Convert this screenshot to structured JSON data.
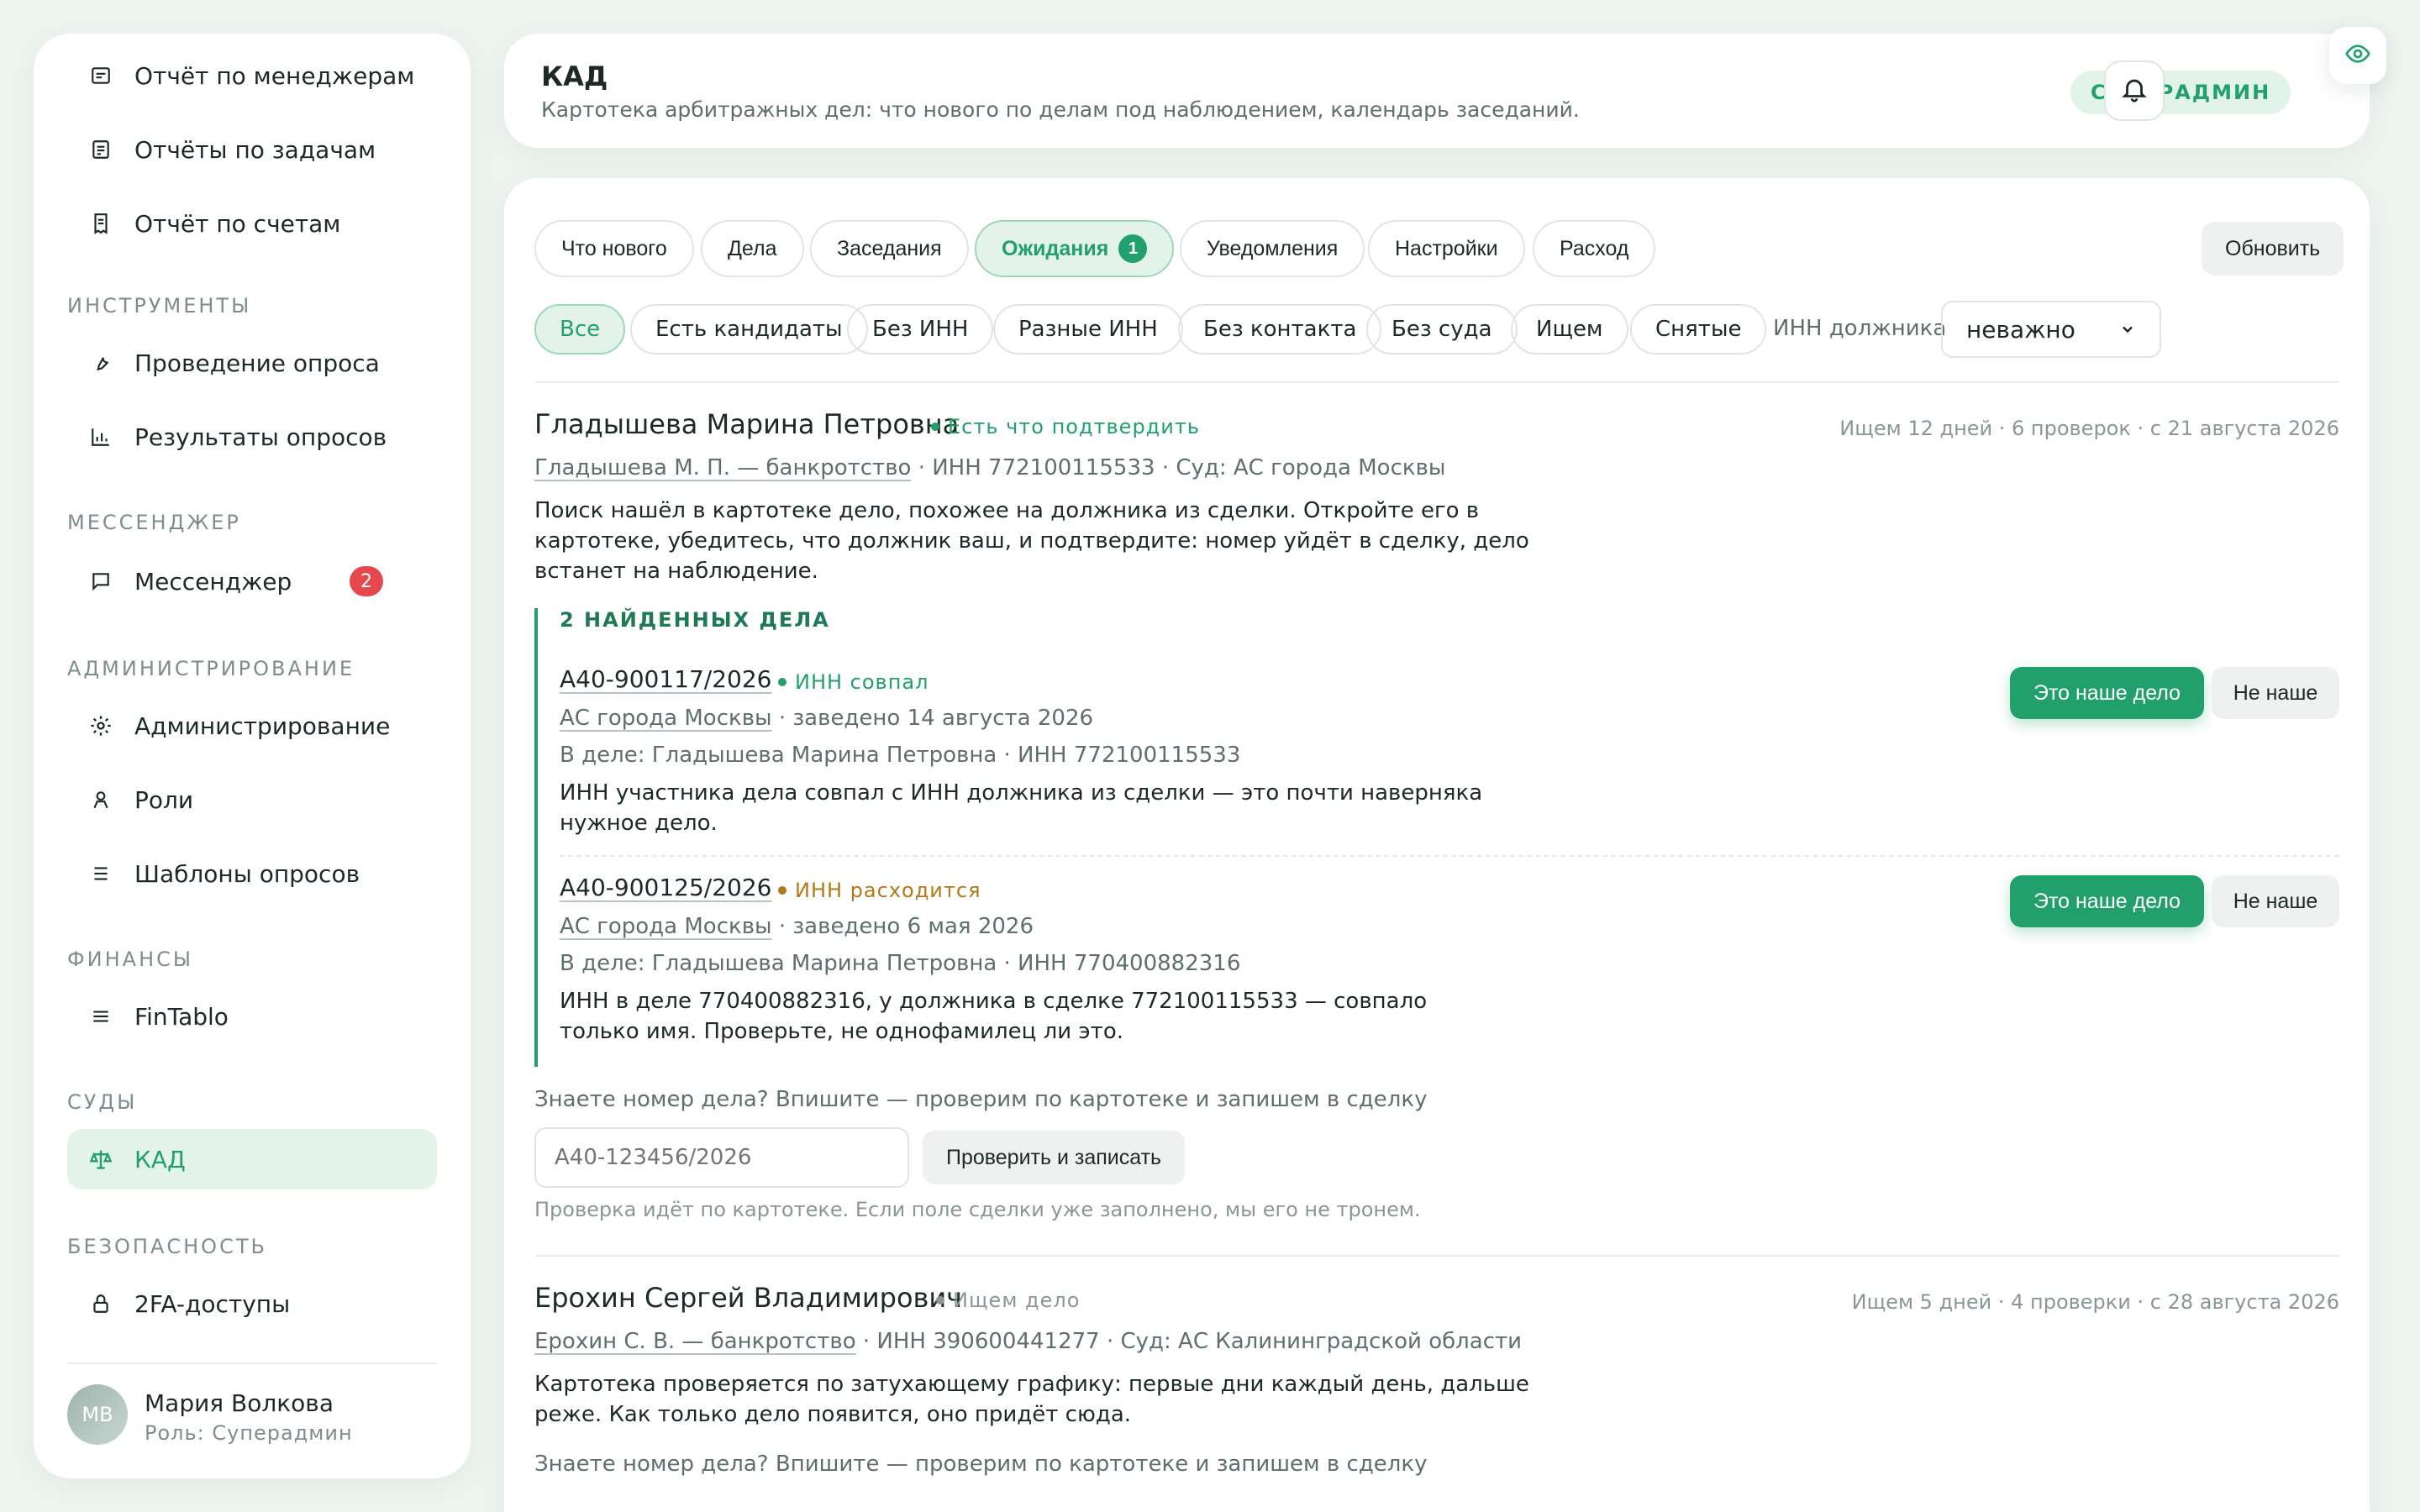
{
  "sidebar": {
    "items_top": [
      {
        "label": "Отчёт по менеджерам",
        "icon": "report-icon"
      },
      {
        "label": "Отчёты по задачам",
        "icon": "tasks-report-icon"
      },
      {
        "label": "Отчёт по счетам",
        "icon": "invoice-icon"
      }
    ],
    "sections": [
      {
        "title": "ИНСТРУМЕНТЫ",
        "items": [
          {
            "label": "Проведение опроса",
            "icon": "wrench-icon"
          },
          {
            "label": "Результаты опросов",
            "icon": "chart-icon"
          }
        ]
      },
      {
        "title": "МЕССЕНДЖЕР",
        "items": [
          {
            "label": "Мессенджер",
            "icon": "chat-icon",
            "badge": "2"
          }
        ]
      },
      {
        "title": "АДМИНИСТРИРОВАНИЕ",
        "items": [
          {
            "label": "Администрирование",
            "icon": "gear-icon"
          },
          {
            "label": "Роли",
            "icon": "person-icon"
          },
          {
            "label": "Шаблоны опросов",
            "icon": "list-icon"
          }
        ]
      },
      {
        "title": "ФИНАНСЫ",
        "items": [
          {
            "label": "FinTablo",
            "icon": "menu-icon"
          }
        ]
      },
      {
        "title": "СУДЫ",
        "items": [
          {
            "label": "КАД",
            "icon": "scales-icon",
            "active": true
          }
        ]
      },
      {
        "title": "БЕЗОПАСНОСТЬ",
        "items": [
          {
            "label": "2FA-доступы",
            "icon": "lock-icon"
          }
        ]
      }
    ],
    "user": {
      "initials": "МВ",
      "name": "Мария Волкова",
      "role": "Роль: Суперадмин"
    }
  },
  "header": {
    "title": "КАД",
    "subtitle": "Картотека арбитражных дел: что нового по делам под наблюдением, календарь заседаний.",
    "role_badge": "СУПЕРАДМИН"
  },
  "tabs": [
    {
      "label": "Что нового"
    },
    {
      "label": "Дела"
    },
    {
      "label": "Заседания"
    },
    {
      "label": "Ожидания",
      "count": "1",
      "active": true
    },
    {
      "label": "Уведомления"
    },
    {
      "label": "Настройки"
    },
    {
      "label": "Расход"
    }
  ],
  "refresh_label": "Обновить",
  "filters": [
    {
      "label": "Все",
      "active": true
    },
    {
      "label": "Есть кандидаты"
    },
    {
      "label": "Без ИНН"
    },
    {
      "label": "Разные ИНН"
    },
    {
      "label": "Без контакта"
    },
    {
      "label": "Без суда"
    },
    {
      "label": "Ищем"
    },
    {
      "label": "Снятые"
    }
  ],
  "inn_filter": {
    "label": "ИНН должника",
    "value": "неважно"
  },
  "deals": [
    {
      "name": "Гладышева Марина Петровна",
      "status": "Есть что подтвердить",
      "meta": "Ищем 12 дней · 6 проверок · с 21 августа 2026",
      "link": "Гладышева М. П. — банкротство",
      "info": " · ИНН 772100115533 · Суд: АС города Москвы",
      "description": "Поиск нашёл в картотеке дело, похожее на должника из сделки. Откройте его в картотеке, убедитесь, что должник ваш, и подтвердите: номер уйдёт в сделку, дело встанет на наблюдение.",
      "found_title": "2 НАЙДЕННЫХ ДЕЛА",
      "cases": [
        {
          "number": "А40-900117/2026",
          "match": "ИНН совпал",
          "court": "АС города Москвы",
          "filed": " · заведено 14 августа 2026",
          "party": "В деле: Гладышева Марина Петровна · ИНН 772100115533",
          "desc": "ИНН участника дела совпал с ИНН должника из сделки — это почти наверняка нужное дело.",
          "confirm": "Это наше дело",
          "reject": "Не наше"
        },
        {
          "number": "А40-900125/2026",
          "match": "ИНН расходится",
          "court": "АС города Москвы",
          "filed": " · заведено 6 мая 2026",
          "party": "В деле: Гладышева Марина Петровна · ИНН 770400882316",
          "desc": "ИНН в деле 770400882316, у должника в сделке 772100115533 — совпало только имя. Проверьте, не однофамилец ли это.",
          "confirm": "Это наше дело",
          "reject": "Не наше"
        }
      ],
      "manual_hint": "Знаете номер дела? Впишите — проверим по картотеке и запишем в сделку",
      "input_placeholder": "А40-123456/2026",
      "check_button": "Проверить и записать",
      "note": "Проверка идёт по картотеке. Если поле сделки уже заполнено, мы его не тронем."
    },
    {
      "name": "Ерохин Сергей Владимирович",
      "status": "Ищем дело",
      "meta": "Ищем 5 дней · 4 проверки · с 28 августа 2026",
      "link": "Ерохин С. В. — банкротство",
      "info": " · ИНН 390600441277 · Суд: АС Калининградской области",
      "description": "Картотека проверяется по затухающему графику: первые дни каждый день, дальше реже. Как только дело появится, оно придёт сюда.",
      "manual_hint": "Знаете номер дела? Впишите — проверим по картотеке и запишем в сделку"
    }
  ],
  "colors": {
    "accent": "#22a06b",
    "warning": "#b07a1a",
    "muted": "#8a9891",
    "badge_red": "#e5484d"
  }
}
